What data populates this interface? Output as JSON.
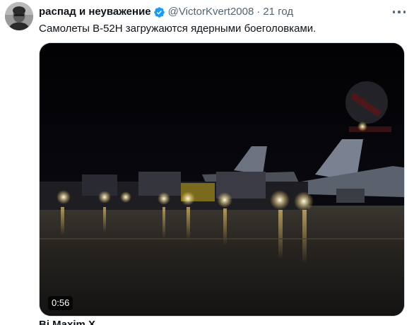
{
  "tweet": {
    "display_name": "распад и неуважение",
    "handle": "@VictorKvert2008",
    "separator": "·",
    "time": "21 год",
    "text": "Самолеты B-52H загружаются ядерными боеголовками.",
    "verified_icon": "verified-badge-icon",
    "more_icon": "more-options-icon"
  },
  "media": {
    "type": "video",
    "duration": "0:56"
  },
  "next_tweet": {
    "prefix": "Bi",
    "author_partial": "Maxim X"
  },
  "colors": {
    "verified_blue": "#1d9bf0",
    "text_primary": "#0f1419",
    "text_secondary": "#536471"
  }
}
